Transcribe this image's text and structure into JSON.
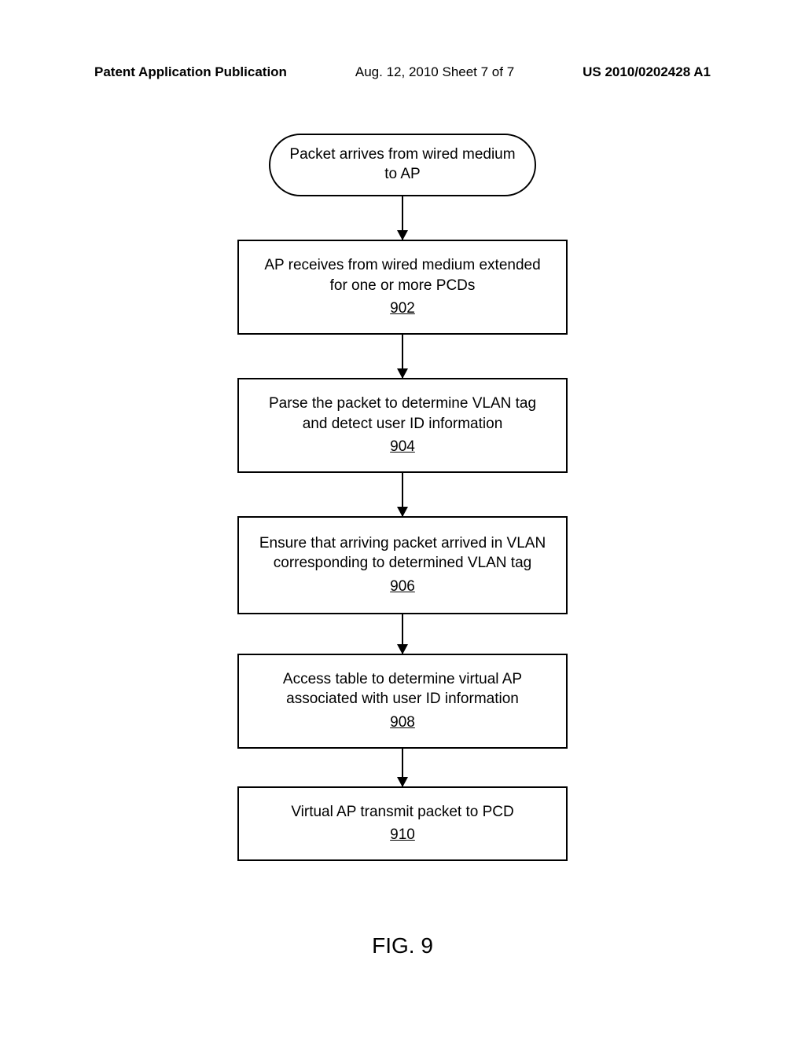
{
  "header": {
    "left": "Patent Application Publication",
    "center": "Aug. 12, 2010  Sheet 7 of 7",
    "right": "US 2010/0202428 A1"
  },
  "flowchart": {
    "start": {
      "text": "Packet arrives from wired medium to AP"
    },
    "steps": [
      {
        "text": "AP receives from wired medium extended for one or more PCDs",
        "ref": "902"
      },
      {
        "text": "Parse the packet to determine VLAN tag and detect user ID information",
        "ref": "904"
      },
      {
        "text": "Ensure that arriving packet arrived in VLAN corresponding to determined VLAN tag",
        "ref": "906"
      },
      {
        "text": "Access table to determine virtual AP associated with user ID information",
        "ref": "908"
      },
      {
        "text": "Virtual AP transmit packet to PCD",
        "ref": "910"
      }
    ]
  },
  "figure_label": "FIG. 9"
}
